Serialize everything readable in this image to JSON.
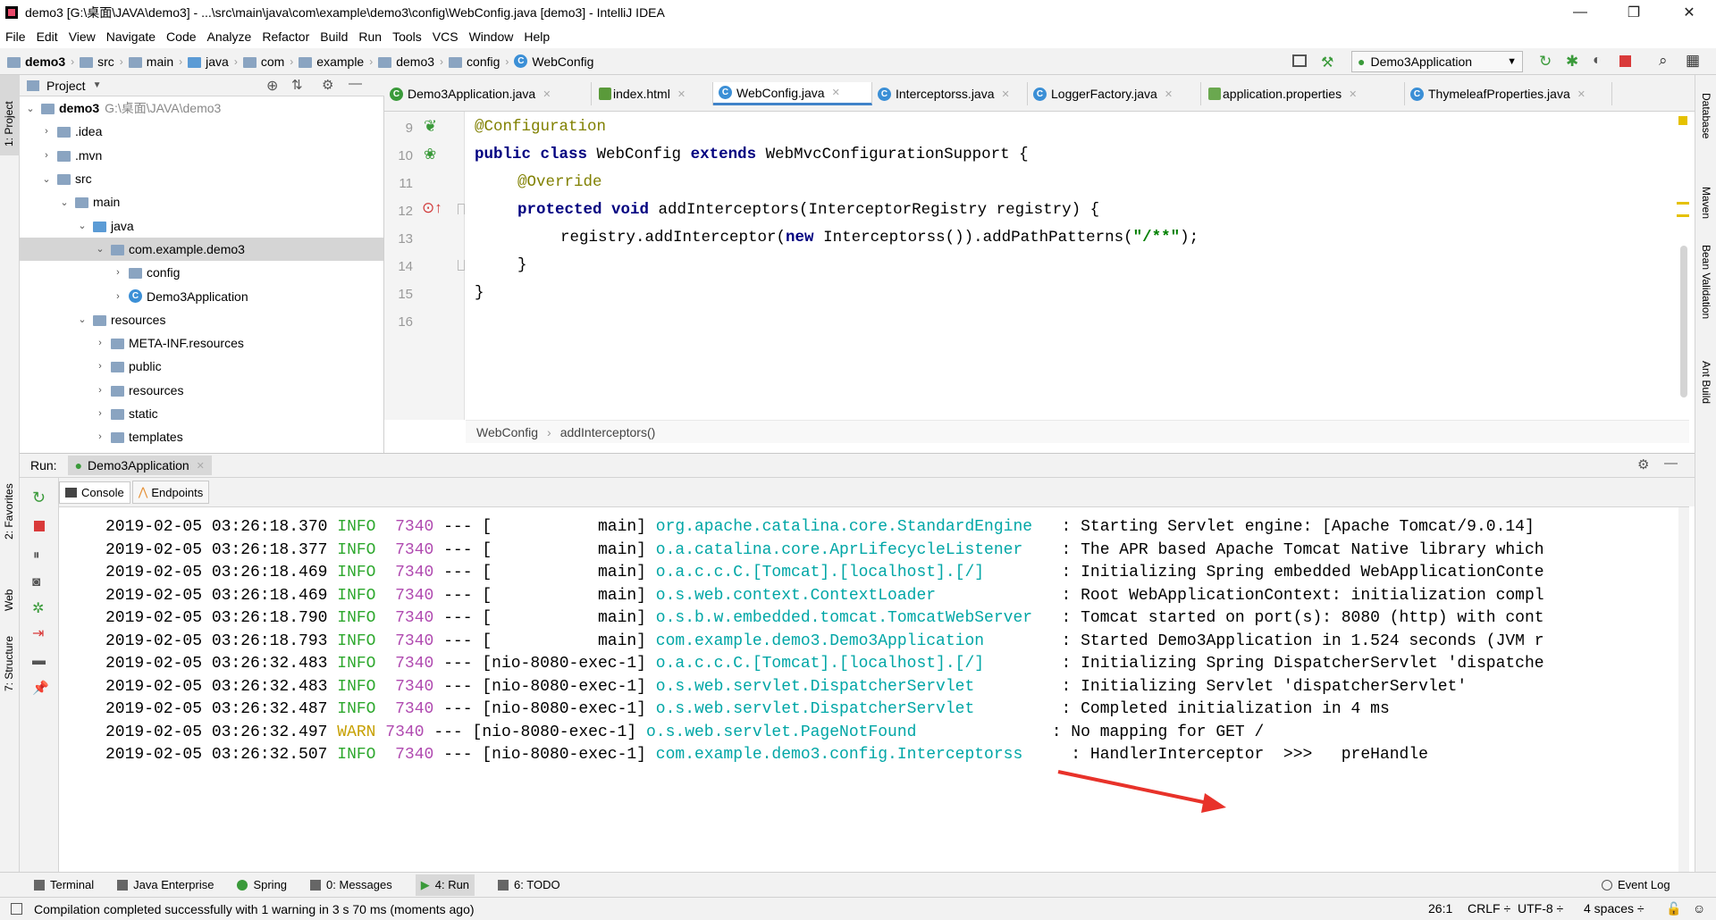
{
  "window": {
    "title": "demo3 [G:\\桌面\\JAVA\\demo3] - ...\\src\\main\\java\\com\\example\\demo3\\config\\WebConfig.java [demo3] - IntelliJ IDEA",
    "minimize": "—",
    "maximize": "❐",
    "close": "✕"
  },
  "menu": [
    "File",
    "Edit",
    "View",
    "Navigate",
    "Code",
    "Analyze",
    "Refactor",
    "Build",
    "Run",
    "Tools",
    "VCS",
    "Window",
    "Help"
  ],
  "breadcrumb": [
    "demo3",
    "src",
    "main",
    "java",
    "com",
    "example",
    "demo3",
    "config",
    "WebConfig"
  ],
  "run_config": "Demo3Application",
  "project_panel": {
    "title": "Project",
    "tree": [
      {
        "label": "demo3",
        "extra": "G:\\桌面\\JAVA\\demo3",
        "depth": 0,
        "arrow": "▾"
      },
      {
        "label": ".idea",
        "depth": 1,
        "arrow": "›"
      },
      {
        "label": ".mvn",
        "depth": 1,
        "arrow": "›"
      },
      {
        "label": "src",
        "depth": 1,
        "arrow": "▾"
      },
      {
        "label": "main",
        "depth": 2,
        "arrow": "▾"
      },
      {
        "label": "java",
        "depth": 3,
        "arrow": "▾"
      },
      {
        "label": "com.example.demo3",
        "depth": 4,
        "arrow": "▾",
        "selected": true
      },
      {
        "label": "config",
        "depth": 5,
        "arrow": "›"
      },
      {
        "label": "Demo3Application",
        "depth": 5,
        "arrow": "›",
        "class": true
      },
      {
        "label": "resources",
        "depth": 3,
        "arrow": "▾"
      },
      {
        "label": "META-INF.resources",
        "depth": 4,
        "arrow": "›"
      },
      {
        "label": "public",
        "depth": 4,
        "arrow": "›"
      },
      {
        "label": "resources",
        "depth": 4,
        "arrow": "›"
      },
      {
        "label": "static",
        "depth": 4,
        "arrow": "›"
      },
      {
        "label": "templates",
        "depth": 4,
        "arrow": "›"
      }
    ]
  },
  "editor_tabs": [
    "Demo3Application.java",
    "index.html",
    "WebConfig.java",
    "Interceptorss.java",
    "LoggerFactory.java",
    "application.properties",
    "ThymeleafProperties.java"
  ],
  "active_tab": "WebConfig.java",
  "line_numbers": [
    "9",
    "10",
    "11",
    "12",
    "13",
    "14",
    "15",
    "16"
  ],
  "code": {
    "l9": "@Configuration",
    "l10_kw1": "public class",
    "l10_name": " WebConfig ",
    "l10_kw2": "extends",
    "l10_rest": " WebMvcConfigurationSupport {",
    "l11": "@Override",
    "l12_kw": "protected void",
    "l12_rest": " addInterceptors(InterceptorRegistry registry) {",
    "l13_a": "registry.addInterceptor(",
    "l13_kw": "new",
    "l13_b": " Interceptorss()).addPathPatterns(",
    "l13_str": "\"/**\"",
    "l13_c": ");",
    "l14": "}",
    "l15": "}"
  },
  "editor_breadcrumb": [
    "WebConfig",
    "addInterceptors()"
  ],
  "run_panel": {
    "label": "Run:",
    "config": "Demo3Application",
    "tabs": [
      "Console",
      "Endpoints"
    ]
  },
  "console_logs": [
    {
      "ts": "2019-02-05 03:26:18.370",
      "level": "INFO",
      "pid": "7340",
      "sep": "---",
      "thread": "[           main]",
      "logger": "org.apache.catalina.core.StandardEngine  ",
      "msg": ": Starting Servlet engine: [Apache Tomcat/9.0.14]"
    },
    {
      "ts": "2019-02-05 03:26:18.377",
      "level": "INFO",
      "pid": "7340",
      "sep": "---",
      "thread": "[           main]",
      "logger": "o.a.catalina.core.AprLifecycleListener   ",
      "msg": ": The APR based Apache Tomcat Native library which"
    },
    {
      "ts": "2019-02-05 03:26:18.469",
      "level": "INFO",
      "pid": "7340",
      "sep": "---",
      "thread": "[           main]",
      "logger": "o.a.c.c.C.[Tomcat].[localhost].[/]       ",
      "msg": ": Initializing Spring embedded WebApplicationConte"
    },
    {
      "ts": "2019-02-05 03:26:18.469",
      "level": "INFO",
      "pid": "7340",
      "sep": "---",
      "thread": "[           main]",
      "logger": "o.s.web.context.ContextLoader            ",
      "msg": ": Root WebApplicationContext: initialization compl"
    },
    {
      "ts": "2019-02-05 03:26:18.790",
      "level": "INFO",
      "pid": "7340",
      "sep": "---",
      "thread": "[           main]",
      "logger": "o.s.b.w.embedded.tomcat.TomcatWebServer  ",
      "msg": ": Tomcat started on port(s): 8080 (http) with cont"
    },
    {
      "ts": "2019-02-05 03:26:18.793",
      "level": "INFO",
      "pid": "7340",
      "sep": "---",
      "thread": "[           main]",
      "logger": "com.example.demo3.Demo3Application       ",
      "msg": ": Started Demo3Application in 1.524 seconds (JVM r"
    },
    {
      "ts": "2019-02-05 03:26:32.483",
      "level": "INFO",
      "pid": "7340",
      "sep": "---",
      "thread": "[nio-8080-exec-1]",
      "logger": "o.a.c.c.C.[Tomcat].[localhost].[/]       ",
      "msg": ": Initializing Spring DispatcherServlet 'dispatche"
    },
    {
      "ts": "2019-02-05 03:26:32.483",
      "level": "INFO",
      "pid": "7340",
      "sep": "---",
      "thread": "[nio-8080-exec-1]",
      "logger": "o.s.web.servlet.DispatcherServlet        ",
      "msg": ": Initializing Servlet 'dispatcherServlet'"
    },
    {
      "ts": "2019-02-05 03:26:32.487",
      "level": "INFO",
      "pid": "7340",
      "sep": "---",
      "thread": "[nio-8080-exec-1]",
      "logger": "o.s.web.servlet.DispatcherServlet        ",
      "msg": ": Completed initialization in 4 ms"
    },
    {
      "ts": "2019-02-05 03:26:32.497",
      "level": "WARN",
      "pid": "7340",
      "sep": "---",
      "thread": "[nio-8080-exec-1]",
      "logger": "o.s.web.servlet.PageNotFound             ",
      "msg": ": No mapping for GET /"
    },
    {
      "ts": "2019-02-05 03:26:32.507",
      "level": "INFO",
      "pid": "7340",
      "sep": "---",
      "thread": "[nio-8080-exec-1]",
      "logger": "com.example.demo3.config.Interceptorss    ",
      "msg": ": HandlerInterceptor  >>>   preHandle"
    }
  ],
  "left_strip": [
    "1: Project",
    "2: Favorites",
    "Web",
    "7: Structure"
  ],
  "right_strip": [
    "Database",
    "Maven",
    "Bean Validation",
    "Ant Build"
  ],
  "bottom_tools": [
    "Terminal",
    "Java Enterprise",
    "Spring",
    "0: Messages",
    "4: Run",
    "6: TODO"
  ],
  "event_log": "Event Log",
  "status": {
    "message": "Compilation completed successfully with 1 warning in 3 s 70 ms (moments ago)",
    "position": "26:1",
    "line_sep": "CRLF ÷",
    "encoding": "UTF-8 ÷",
    "indent": "4 spaces ÷"
  },
  "colors": {
    "info": "#2ea82e",
    "warn": "#c7a000",
    "logger": "#00a6a6",
    "pid": "#b04ab0",
    "keyword": "#000080",
    "annotation": "#808000",
    "arrow": "#e8322a"
  }
}
